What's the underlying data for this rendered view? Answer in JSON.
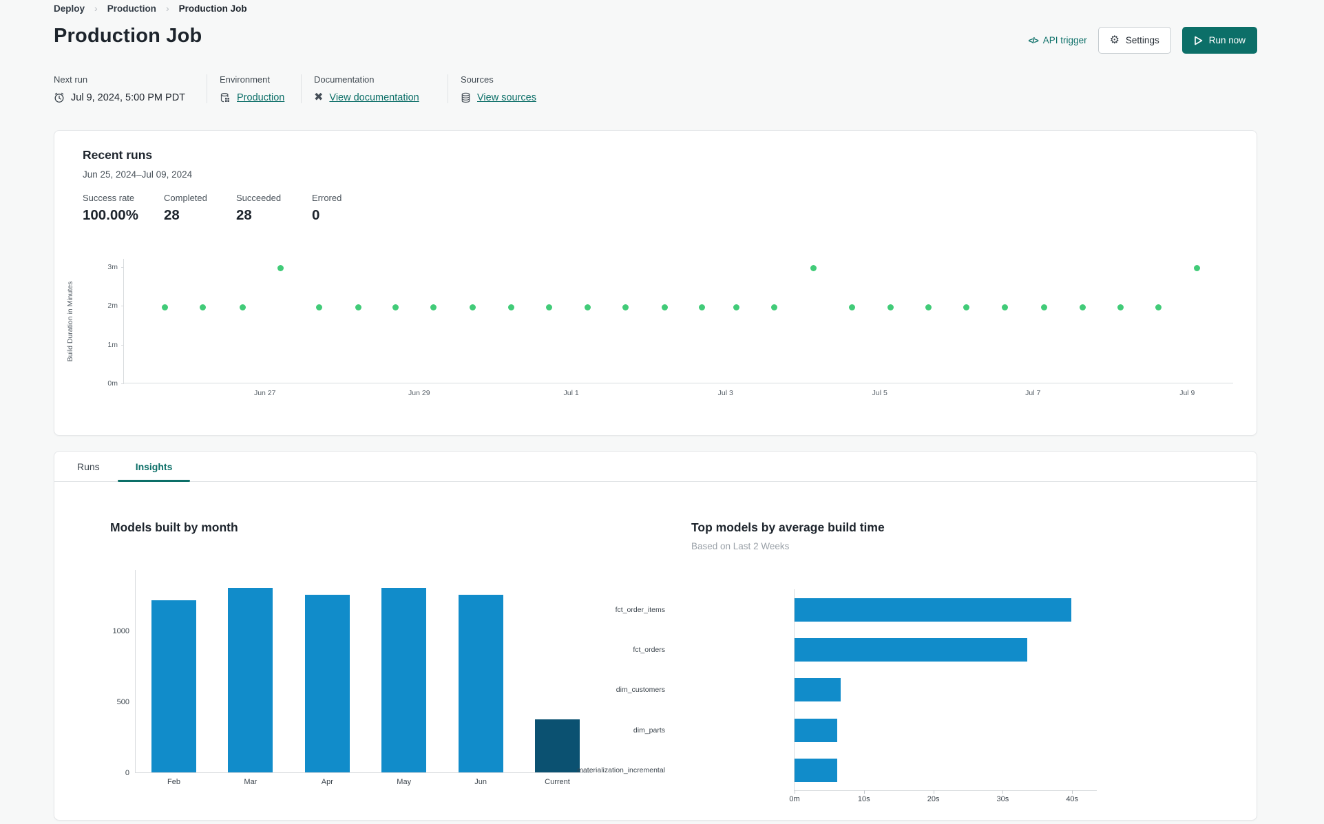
{
  "breadcrumb": {
    "items": [
      {
        "label": "Deploy"
      },
      {
        "label": "Production"
      },
      {
        "label": "Production Job"
      }
    ]
  },
  "header": {
    "title": "Production Job",
    "api_trigger_label": "API trigger",
    "api_trigger_glyph": "</>",
    "settings_label": "Settings",
    "run_now_label": "Run now"
  },
  "meta": {
    "next_run": {
      "label": "Next run",
      "value": "Jul 9, 2024, 5:00 PM PDT",
      "icon": "clock-icon"
    },
    "environment": {
      "label": "Environment",
      "value": "Production",
      "icon": "environment-database-icon"
    },
    "documentation": {
      "label": "Documentation",
      "value": "View documentation",
      "icon": "dbt-docs-icon"
    },
    "sources": {
      "label": "Sources",
      "value": "View sources",
      "icon": "sources-database-icon"
    }
  },
  "recent_runs": {
    "title": "Recent runs",
    "date_range": "Jun 25, 2024–Jul 09, 2024",
    "stats": [
      {
        "label": "Success rate",
        "value": "100.00%"
      },
      {
        "label": "Completed",
        "value": "28"
      },
      {
        "label": "Succeeded",
        "value": "28"
      },
      {
        "label": "Errored",
        "value": "0"
      }
    ]
  },
  "tabs": [
    {
      "label": "Runs",
      "active": false
    },
    {
      "label": "Insights",
      "active": true
    }
  ],
  "colors": {
    "accent_teal": "#0c6f68",
    "dot_green": "#41cb78",
    "bar_blue": "#118cca",
    "bar_navy": "#0b5171",
    "page_bg": "#f7f8f8"
  },
  "chart_data": [
    {
      "id": "build_duration_scatter",
      "type": "scatter",
      "title": "Recent runs",
      "ylabel": "Build Duration in Minutes",
      "ylim_minutes": [
        0,
        3.2
      ],
      "y_ticks": [
        {
          "label": "3m",
          "m": 3
        },
        {
          "label": "2m",
          "m": 2
        },
        {
          "label": "1m",
          "m": 1
        },
        {
          "label": "0m",
          "m": 0
        }
      ],
      "x_ticks": [
        {
          "label": "Jun 27",
          "f": 0.127
        },
        {
          "label": "Jun 29",
          "f": 0.266
        },
        {
          "label": "Jul 1",
          "f": 0.403
        },
        {
          "label": "Jul 3",
          "f": 0.542
        },
        {
          "label": "Jul 5",
          "f": 0.681
        },
        {
          "label": "Jul 7",
          "f": 0.819
        },
        {
          "label": "Jul 9",
          "f": 0.958
        }
      ],
      "points": [
        {
          "f": 0.037,
          "minutes": 1.97
        },
        {
          "f": 0.071,
          "minutes": 1.97
        },
        {
          "f": 0.107,
          "minutes": 1.97
        },
        {
          "f": 0.141,
          "minutes": 2.97
        },
        {
          "f": 0.176,
          "minutes": 1.97
        },
        {
          "f": 0.211,
          "minutes": 1.97
        },
        {
          "f": 0.245,
          "minutes": 1.97
        },
        {
          "f": 0.279,
          "minutes": 1.97
        },
        {
          "f": 0.314,
          "minutes": 1.97
        },
        {
          "f": 0.349,
          "minutes": 1.97
        },
        {
          "f": 0.383,
          "minutes": 1.97
        },
        {
          "f": 0.418,
          "minutes": 1.97
        },
        {
          "f": 0.452,
          "minutes": 1.97
        },
        {
          "f": 0.487,
          "minutes": 1.97
        },
        {
          "f": 0.521,
          "minutes": 1.97
        },
        {
          "f": 0.552,
          "minutes": 1.97
        },
        {
          "f": 0.586,
          "minutes": 1.97
        },
        {
          "f": 0.621,
          "minutes": 2.97
        },
        {
          "f": 0.656,
          "minutes": 1.97
        },
        {
          "f": 0.691,
          "minutes": 1.97
        },
        {
          "f": 0.725,
          "minutes": 1.97
        },
        {
          "f": 0.759,
          "minutes": 1.97
        },
        {
          "f": 0.794,
          "minutes": 1.97
        },
        {
          "f": 0.829,
          "minutes": 1.97
        },
        {
          "f": 0.864,
          "minutes": 1.97
        },
        {
          "f": 0.898,
          "minutes": 1.97
        },
        {
          "f": 0.932,
          "minutes": 1.97
        },
        {
          "f": 0.967,
          "minutes": 2.97
        }
      ],
      "point_color": "#41cb78",
      "grid": false
    },
    {
      "id": "models_built_by_month",
      "type": "bar",
      "title": "Models built by month",
      "categories": [
        "Feb",
        "Mar",
        "Apr",
        "May",
        "Jun",
        "Current"
      ],
      "values": [
        1210,
        1300,
        1250,
        1300,
        1250,
        375
      ],
      "y_ticks": [
        0,
        500,
        1000
      ],
      "ylim": [
        0,
        1430
      ],
      "bar_color": "#118cca",
      "highlight_category": "Current",
      "highlight_color": "#0b5171",
      "grid": false
    },
    {
      "id": "top_models_by_build_time",
      "type": "bar-horizontal",
      "title": "Top models by average build time",
      "subtitle": "Based on Last 2 Weeks",
      "categories": [
        "fct_order_items",
        "fct_orders",
        "dim_customers",
        "dim_parts",
        "materialization_incremental"
      ],
      "values_seconds": [
        39.9,
        33.5,
        6.6,
        6.2,
        6.2
      ],
      "x_ticks": [
        {
          "label": "0m",
          "s": 0
        },
        {
          "label": "10s",
          "s": 10
        },
        {
          "label": "20s",
          "s": 20
        },
        {
          "label": "30s",
          "s": 30
        },
        {
          "label": "40s",
          "s": 40
        }
      ],
      "xlim_seconds": [
        0,
        44
      ],
      "bar_color": "#118cca",
      "grid": false
    }
  ]
}
